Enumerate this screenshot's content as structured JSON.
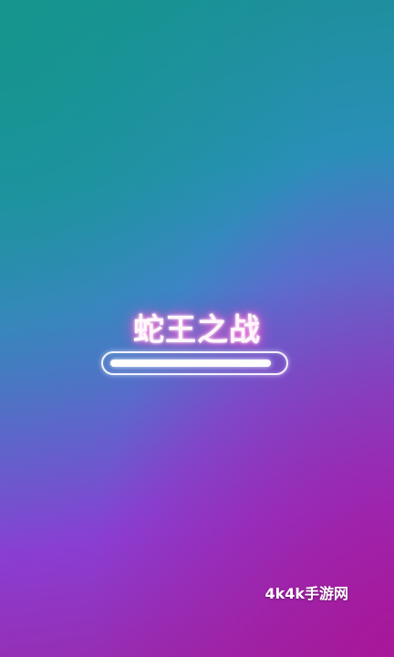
{
  "game": {
    "title": "蛇王之战"
  },
  "loading": {
    "progress": 0.95
  },
  "watermark": {
    "text": "4k4k手游网"
  },
  "colors": {
    "top_left": "#1a8f95",
    "middle": "#4b7fd8",
    "bottom_right": "#9a28a8",
    "title_glow": "#ff50c8"
  }
}
